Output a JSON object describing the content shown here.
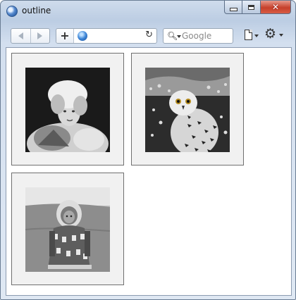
{
  "window": {
    "title": "outline"
  },
  "toolbar": {
    "search_placeholder": "Google"
  },
  "gallery": {
    "images": [
      {
        "subject": "portrait-woman-fur-hat"
      },
      {
        "subject": "snowy-owl"
      },
      {
        "subject": "child-fur-parka"
      }
    ]
  }
}
